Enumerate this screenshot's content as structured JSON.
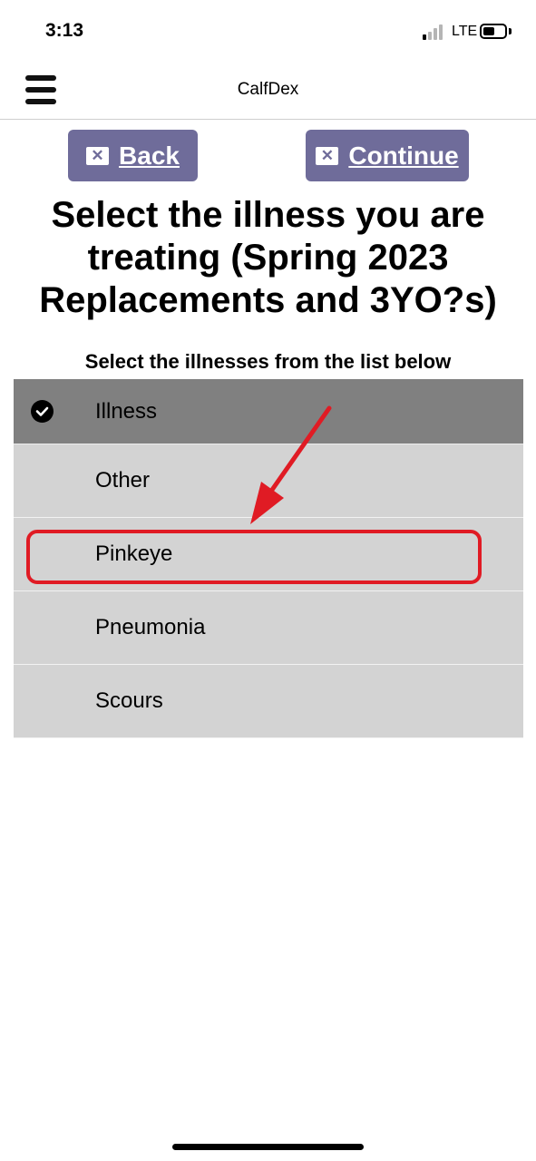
{
  "status_bar": {
    "time": "3:13",
    "network": "LTE"
  },
  "nav": {
    "title": "CalfDex"
  },
  "buttons": {
    "back_label": "Back",
    "continue_label": "Continue"
  },
  "page": {
    "title": "Select the illness you are treating (Spring 2023 Replacements and 3YO?s)",
    "subtitle": "Select the illnesses from the list below"
  },
  "list": {
    "header": "Illness",
    "items": [
      "Other",
      "Pinkeye",
      "Pneumonia",
      "Scours"
    ]
  },
  "colors": {
    "button": "#6f6c9a",
    "header_row": "#808080",
    "row": "#d3d3d3",
    "annotation": "#e01b24"
  }
}
